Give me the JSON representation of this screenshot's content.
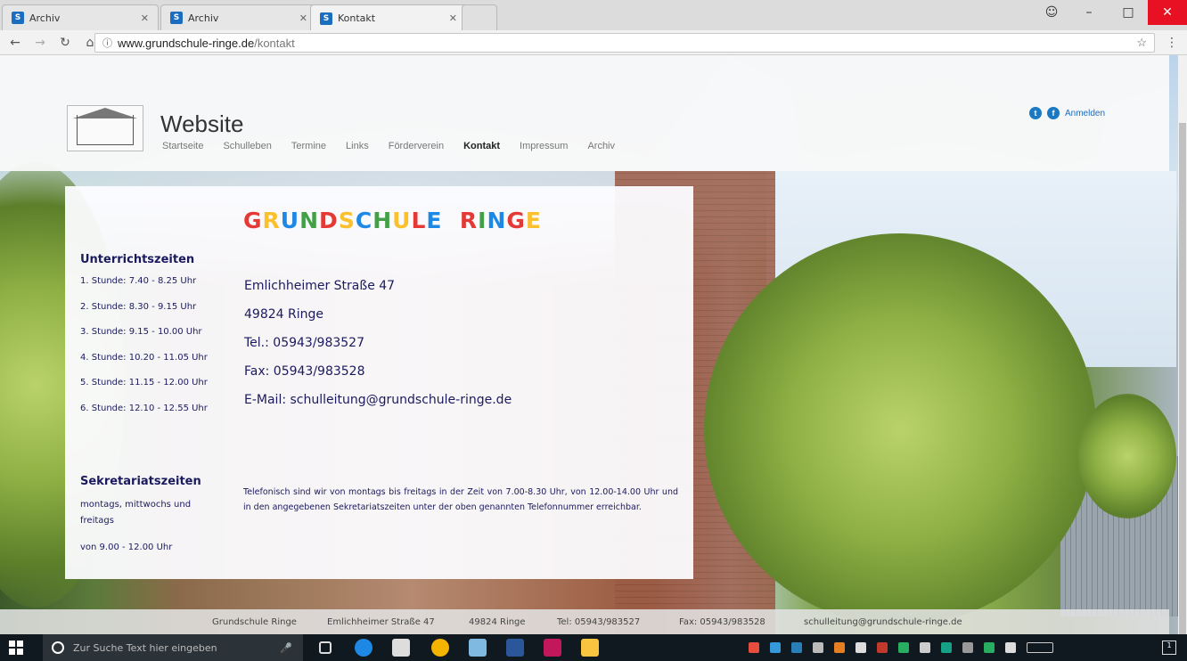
{
  "browser": {
    "tabs": [
      {
        "label": "Archiv"
      },
      {
        "label": "Archiv"
      },
      {
        "label": "Kontakt"
      }
    ],
    "url_host": "www.grundschule-ringe.de",
    "url_path": "/kontakt"
  },
  "site": {
    "title": "Website",
    "nav": [
      "Startseite",
      "Schulleben",
      "Termine",
      "Links",
      "Förderverein",
      "Kontakt",
      "Impressum",
      "Archiv"
    ],
    "current_nav": "Kontakt",
    "login": "Anmelden"
  },
  "content": {
    "school_name_parts": [
      {
        "text": "G",
        "color": "#e53935"
      },
      {
        "text": "R",
        "color": "#fbc02d"
      },
      {
        "text": "U",
        "color": "#1e88e5"
      },
      {
        "text": "N",
        "color": "#43a047"
      },
      {
        "text": "D",
        "color": "#e53935"
      },
      {
        "text": "S",
        "color": "#fbc02d"
      },
      {
        "text": "C",
        "color": "#1e88e5"
      },
      {
        "text": "H",
        "color": "#43a047"
      },
      {
        "text": "U",
        "color": "#fbc02d"
      },
      {
        "text": "L",
        "color": "#e53935"
      },
      {
        "text": "E",
        "color": "#1e88e5"
      },
      {
        "text": "  ",
        "color": "#000000"
      },
      {
        "text": "R",
        "color": "#e53935"
      },
      {
        "text": "I",
        "color": "#43a047"
      },
      {
        "text": "N",
        "color": "#1e88e5"
      },
      {
        "text": "G",
        "color": "#e53935"
      },
      {
        "text": "E",
        "color": "#fbc02d"
      }
    ],
    "unterricht_title": "Unterrichtszeiten",
    "times": [
      "1. Stunde:  7.40 - 8.25 Uhr",
      "2. Stunde:  8.30 - 9.15 Uhr",
      "3. Stunde:  9.15 - 10.00 Uhr",
      "4. Stunde: 10.20 - 11.05 Uhr",
      "5. Stunde: 11.15 - 12.00 Uhr",
      "6. Stunde: 12.10 - 12.55 Uhr"
    ],
    "address": [
      "Emlichheimer Straße 47",
      "49824 Ringe",
      "Tel.: 05943/983527",
      "Fax: 05943/983528",
      "E-Mail: schulleitung@grundschule-ringe.de"
    ],
    "sekretariat_title": "Sekretariatszeiten",
    "sekretariat_days": "montags, mittwochs und freitags",
    "sekretariat_hours": "von 9.00 - 12.00 Uhr",
    "phone_note": "Telefonisch sind wir von montags bis freitags in der Zeit von 7.00-8.30 Uhr, von 12.00-14.00 Uhr und in den angegebenen Sekretariatszeiten unter der oben genannten Telefonnummer erreichbar."
  },
  "footer": {
    "name": "Grundschule Ringe",
    "street": "Emlichheimer Straße 47",
    "city": "49824 Ringe",
    "tel": "Tel: 05943/983527",
    "fax": "Fax: 05943/983528",
    "email": "schulleitung@grundschule-ringe.de"
  },
  "taskbar": {
    "search_placeholder": "Zur Suche Text hier eingeben"
  }
}
